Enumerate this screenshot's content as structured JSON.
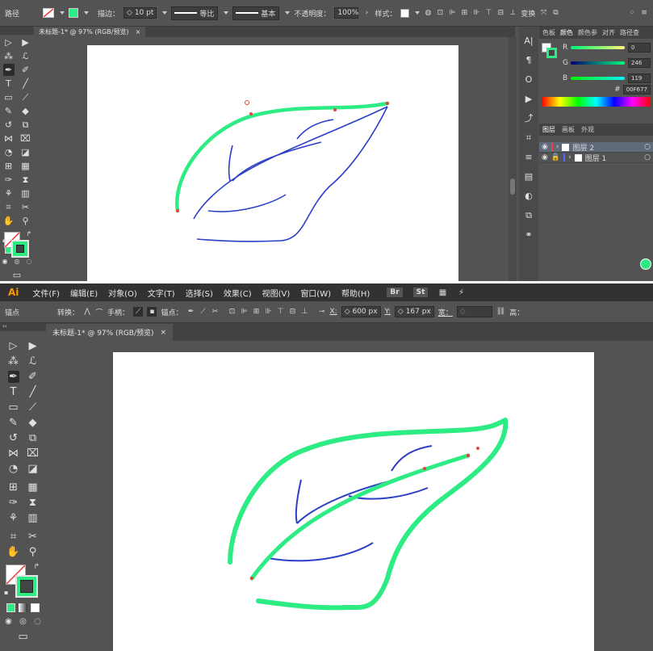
{
  "top": {
    "control_bar": {
      "selection_label": "路径",
      "stroke_label": "描边：",
      "stroke_value": "10 pt",
      "profile_label": "等比",
      "brush_label": "基本",
      "opacity_label": "不透明度：",
      "opacity_value": "100%",
      "style_label": "样式：",
      "transform_label": "变换"
    },
    "doc_tab": {
      "title": "未标题-1* @ 97% (RGB/预览)",
      "close": "×"
    },
    "color_panel": {
      "tabs": [
        "色板",
        "颜色",
        "颜色参",
        "对齐",
        "路径查"
      ],
      "active_tab": "颜色",
      "r_label": "R",
      "r_value": "0",
      "g_label": "G",
      "g_value": "246",
      "b_label": "B",
      "b_value": "119",
      "hex_prefix": "#",
      "hex_value": "00F677"
    },
    "layers_panel": {
      "tabs": [
        "图层",
        "画板",
        "外观"
      ],
      "active_tab": "图层",
      "layers": [
        {
          "name": "图层 2",
          "color": "#ff3b3b"
        },
        {
          "name": "图层 1",
          "color": "#4a6cff"
        }
      ]
    }
  },
  "bottom": {
    "menu": {
      "logo": "Ai",
      "items": [
        "文件(F)",
        "编辑(E)",
        "对象(O)",
        "文字(T)",
        "选择(S)",
        "效果(C)",
        "视图(V)",
        "窗口(W)",
        "帮助(H)"
      ],
      "br_badge": "Br",
      "st_badge": "St"
    },
    "control_bar": {
      "selection_label": "锚点",
      "convert_label": "转换：",
      "handles_label": "手柄：",
      "anchor_label": "锚点：",
      "x_label": "X:",
      "x_value": "600 px",
      "y_label": "Y:",
      "y_value": "167 px",
      "width_label": "宽：",
      "height_label": "高："
    },
    "doc_tab": {
      "title": "未标题-1* @ 97% (RGB/预览)",
      "close": "×"
    }
  },
  "colors": {
    "accent_green": "#2eec84",
    "stroke_blue": "#2b3fc7",
    "anchor_red": "#e0473b"
  }
}
